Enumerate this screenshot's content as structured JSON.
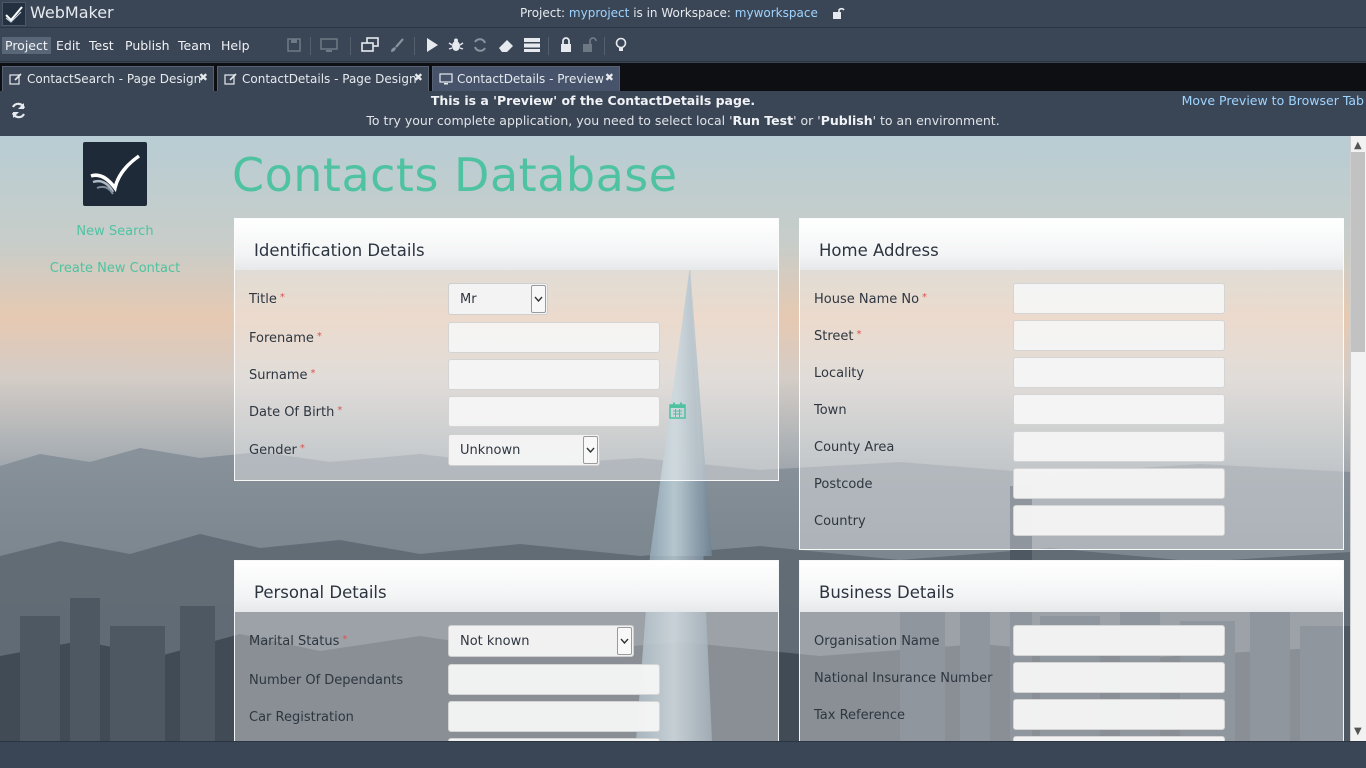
{
  "app": {
    "name": "WebMaker",
    "workspace_prefix": "Project: ",
    "project": "myproject",
    "workspace_mid": " is in Workspace: ",
    "workspace": "myworkspace"
  },
  "menu": [
    "Project",
    "Edit",
    "Test",
    "Publish",
    "Team",
    "Help"
  ],
  "tabs": [
    {
      "label": "ContactSearch - Page Design",
      "icon": "edit-icon"
    },
    {
      "label": "ContactDetails - Page Design",
      "icon": "edit-icon"
    },
    {
      "label": "ContactDetails - Preview",
      "icon": "monitor-icon"
    }
  ],
  "banner": {
    "line1": "This is a 'Preview' of the ContactDetails page.",
    "line2_a": "To try your complete application, you need to select local '",
    "run_test": "Run Test",
    "line2_b": "' or '",
    "publish": "Publish",
    "line2_c": "' to an environment.",
    "move_link": "Move Preview to Browser Tab"
  },
  "page": {
    "heading": "Contacts Database",
    "side_links": [
      "New Search",
      "Create New Contact"
    ],
    "accent_color": "#4fc3a1"
  },
  "identification": {
    "title": "Identification Details",
    "fields": {
      "title_label": "Title",
      "title_value": "Mr",
      "forename": "Forename",
      "surname": "Surname",
      "dob": "Date Of Birth",
      "gender_label": "Gender",
      "gender_value": "Unknown"
    }
  },
  "home_address": {
    "title": "Home Address",
    "fields": [
      "House Name No",
      "Street",
      "Locality",
      "Town",
      "County Area",
      "Postcode",
      "Country"
    ]
  },
  "personal": {
    "title": "Personal Details",
    "marital_label": "Marital Status",
    "marital_value": "Not known",
    "dependants": "Number Of Dependants",
    "car": "Car Registration"
  },
  "business": {
    "title": "Business Details",
    "fields": [
      "Organisation Name",
      "National Insurance Number",
      "Tax Reference"
    ]
  }
}
